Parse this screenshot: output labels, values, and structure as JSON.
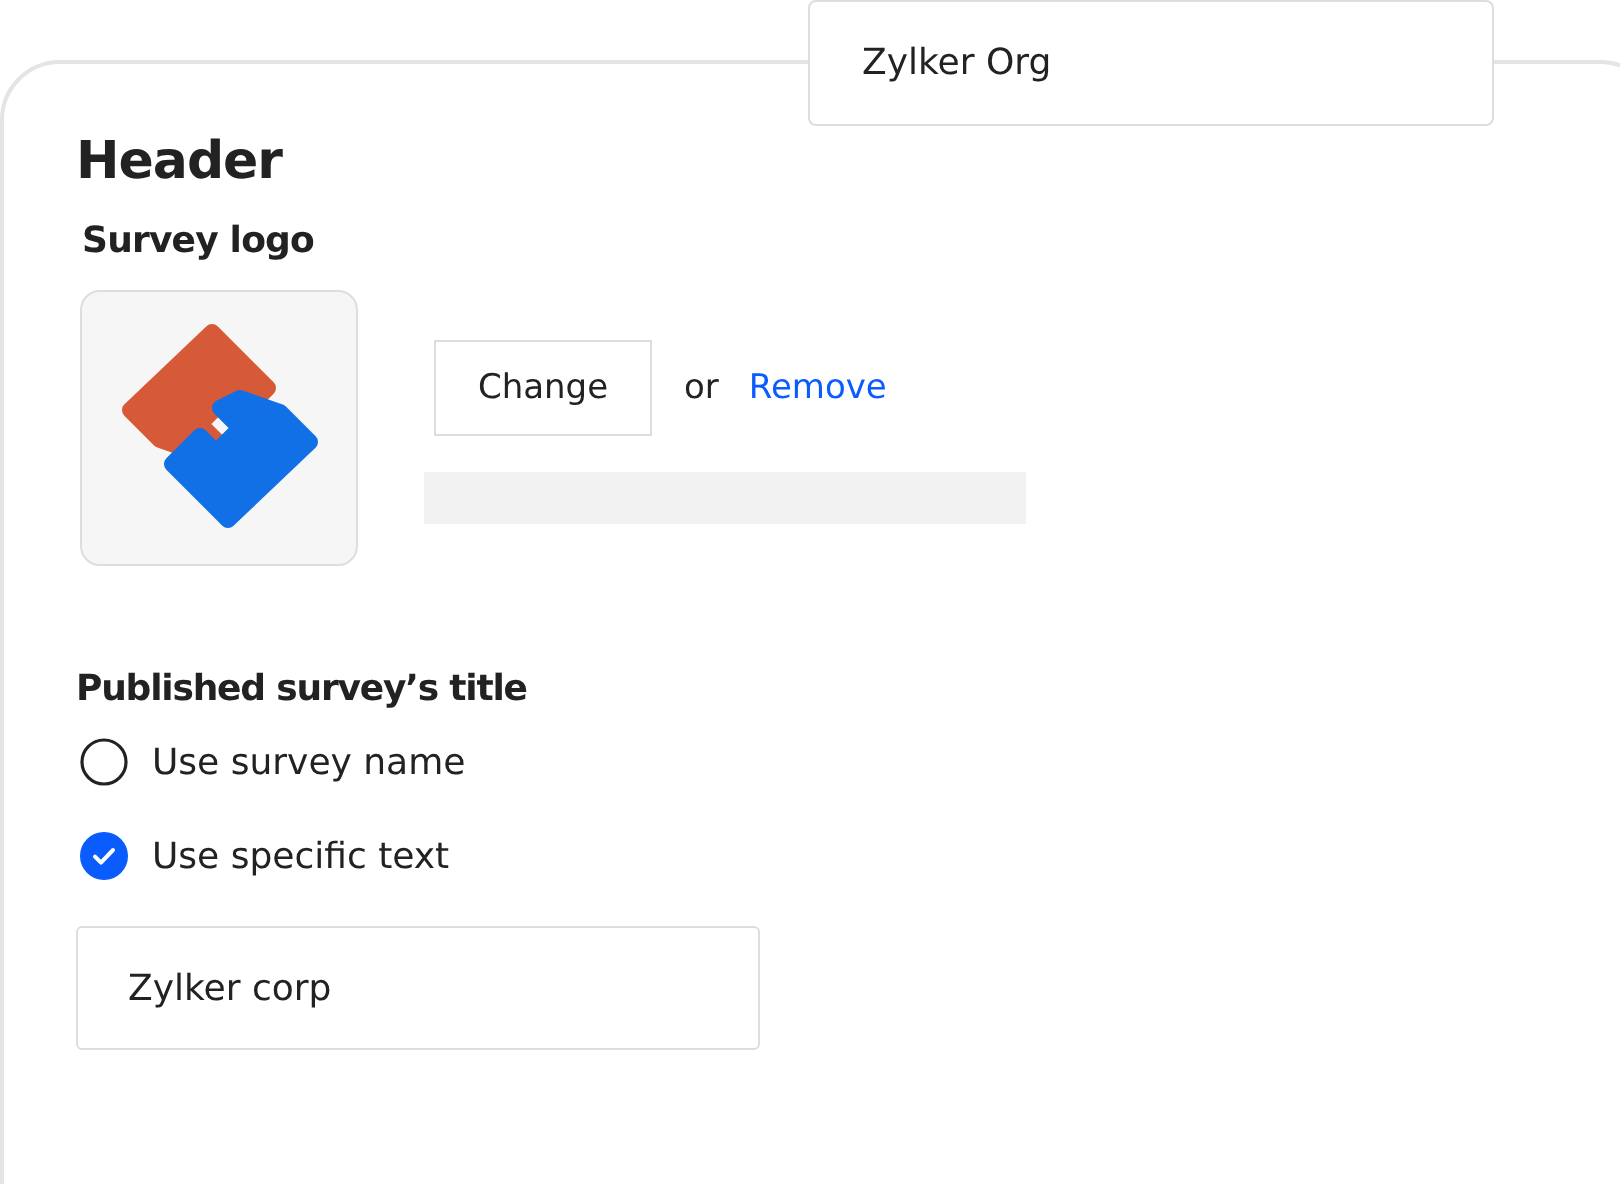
{
  "org_field": {
    "value": "Zylker Org"
  },
  "section": {
    "title": "Header"
  },
  "logo": {
    "label": "Survey logo",
    "change_button": "Change",
    "separator": "or",
    "remove_link": "Remove"
  },
  "title_setting": {
    "label": "Published survey’s title",
    "options": [
      {
        "label": "Use survey name",
        "selected": false
      },
      {
        "label": "Use specific text",
        "selected": true
      }
    ],
    "text_field": {
      "value": "Zylker corp"
    }
  }
}
